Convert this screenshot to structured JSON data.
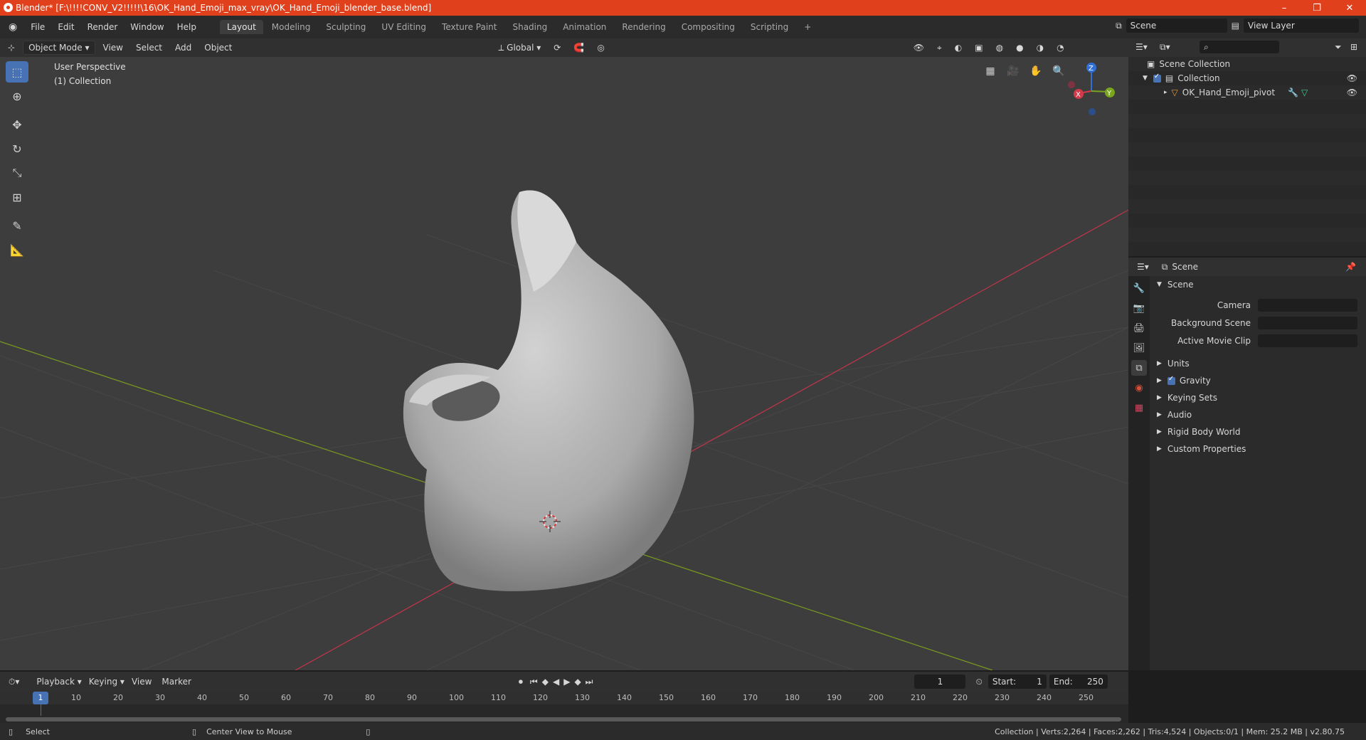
{
  "window": {
    "title": "Blender* [F:\\!!!!CONV_V2!!!!!\\16\\OK_Hand_Emoji_max_vray\\OK_Hand_Emoji_blender_base.blend]",
    "minimize": "–",
    "maximize": "❐",
    "close": "✕"
  },
  "menus": [
    "File",
    "Edit",
    "Render",
    "Window",
    "Help"
  ],
  "workspaces": [
    "Layout",
    "Modeling",
    "Sculpting",
    "UV Editing",
    "Texture Paint",
    "Shading",
    "Animation",
    "Rendering",
    "Compositing",
    "Scripting"
  ],
  "workspace_add": "+",
  "scene_field": "Scene",
  "view_layer_field": "View Layer",
  "viewport_header": {
    "mode": "Object Mode",
    "menus": [
      "View",
      "Select",
      "Add",
      "Object"
    ],
    "transform_orientation": "Global"
  },
  "viewport": {
    "perspective_label": "User Perspective",
    "collection_label": "(1) Collection",
    "gizmo": {
      "z": "Z",
      "y": "Y",
      "x": "X"
    }
  },
  "outliner": {
    "root": "Scene Collection",
    "collection": "Collection",
    "object": "OK_Hand_Emoji_pivot"
  },
  "properties": {
    "header": "Scene",
    "panel": "Scene",
    "fields": [
      {
        "label": "Camera"
      },
      {
        "label": "Background Scene"
      },
      {
        "label": "Active Movie Clip"
      }
    ],
    "sections": [
      "Units",
      "Gravity",
      "Keying Sets",
      "Audio",
      "Rigid Body World",
      "Custom Properties"
    ]
  },
  "timeline": {
    "menus": [
      "Playback",
      "Keying",
      "View",
      "Marker"
    ],
    "current_frame": "1",
    "start_label": "Start:",
    "start": "1",
    "end_label": "End:",
    "end": "250",
    "ruler": [
      "1",
      "10",
      "20",
      "30",
      "40",
      "50",
      "60",
      "70",
      "80",
      "90",
      "100",
      "110",
      "120",
      "130",
      "140",
      "150",
      "160",
      "170",
      "180",
      "190",
      "200",
      "210",
      "220",
      "230",
      "240",
      "250"
    ]
  },
  "statusbar": {
    "left": "Select",
    "middle": "Center View to Mouse",
    "right": "Collection | Verts:2,264 | Faces:2,262 | Tris:4,524 | Objects:0/1 | Mem: 25.2 MB | v2.80.75"
  },
  "colors": {
    "accent": "#4772b3",
    "titlebar": "#e0401c",
    "x_axis": "#c4344a",
    "y_axis": "#7a9a1e"
  }
}
